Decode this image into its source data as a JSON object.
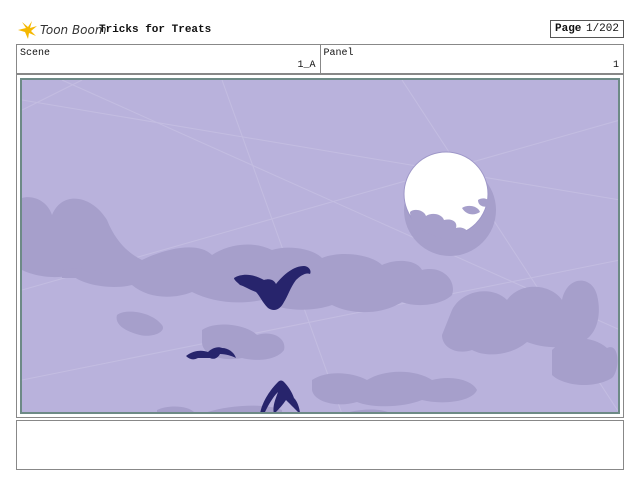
{
  "header": {
    "logo_text": "Toon Boom",
    "title": "Tricks for Treats",
    "page_label": "Page",
    "page_value": "1/202"
  },
  "info": {
    "scene_label": "Scene",
    "scene_value": "1_A",
    "panel_label": "Panel",
    "panel_value": "1"
  },
  "panel_art": {
    "sky_color": "#b9b2dc",
    "cloud_color": "#a69fcb",
    "moon_color": "#ffffff",
    "bat_color": "#27246c"
  },
  "notes": {
    "text": ""
  }
}
